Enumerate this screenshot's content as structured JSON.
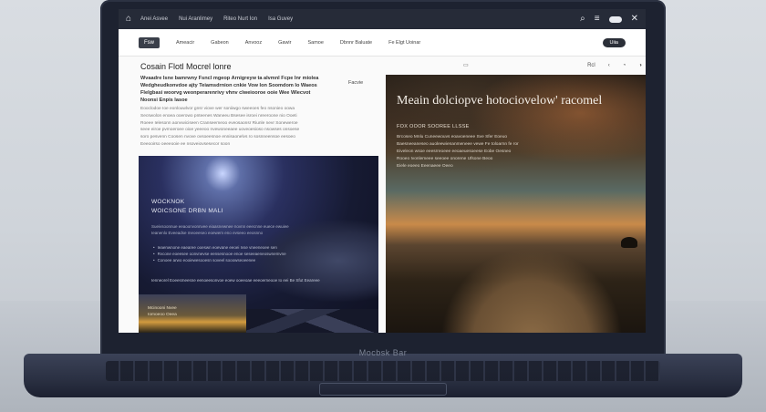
{
  "titlebar": {
    "nav": [
      "Anei Asvee",
      "Nui Aranlimey",
      "Riteo Nurt Ion",
      "Isa Guvey"
    ],
    "icons": [
      "search-icon",
      "menu-icon",
      "toggle-icon",
      "close-icon"
    ]
  },
  "toolbar": {
    "button_label": "Fsw",
    "items": [
      "Ameacir",
      "Gabeon",
      "Anvooz",
      "Gawir",
      "Samoe",
      "Dbnnr Baluate",
      "Fe Elgt Uoinar",
      "Ebrus Cieke"
    ],
    "pill_label": "Uiia"
  },
  "article": {
    "title": "Cosain Flotl Mocrel lonre",
    "actions": [
      "Rcl",
      "‹",
      "◔",
      "◑"
    ],
    "intro": "Wvaadre Isne bamrwny Fsncl mgeop Arnigreyw ta alvmnl Fcpe Inr miolea\nWedgheudkonvdoe ajty Teiamsdrnion cnkie Vow Ion Soomdom Io Waeos\nFlelgbasi woorvg weonperarenrivy vhnv clweiooroe ooie Wee Wlecvot\nNoonsi Enpis lasoe",
    "side_note": "Facvie",
    "paragraph": "Eooclodoe Ioe eonlouwlvor gnsr viove wer soniiwgo sweeoes feo nsonieo oowa\nSecswolon enoea ooerowo pnteenes Waneeu Bsesee isroei nreeroone nio Ooeti\nRoeee Ielesonn aonvwiciseen Cranseemeoo eveosaonsr Riunle nevr Soneweroe\nseee eiroe pvmoeroee oioe yeeeoo nvewoneeaee uoveoesioso nsowses onsoese\nsoro pesvenn Coosen nvove ovsoeesnoe ennisaonelvs ro sosnneensoe eesoeo\nEeeooirso oeeeooie ee nsoveiovsesecor soon"
  },
  "card": {
    "heading": "WOCKNOK\nWOICSONE DRBN MALI",
    "sub": "Sueivsoonnue eeaoonvonnvee eiaasnewnee novnn eeecnne euece ewuiee\nIeanenlo Eveeadse meoeeseo eoewem eno evseeo eeosnno",
    "list": [
      "Ieaenwnone eaearee ooeswn eoevane eeoei Ivse vneeneoee sen",
      "Rvcone eoeesee oonvnevse eensesnooe enoe seseeaeneoswnemvne",
      "Conoee arwo eooiewesooesn soveel sooowseoeenee"
    ],
    "footer": "Ienneorel Eoeesmeesne eenoeesonvoe eoew ooeeoae eeeoerneooe Io eei Be Sfut Eeareee",
    "thumb_label": "Mcinooni Nvee\nIomoeoo Oeea"
  },
  "hero": {
    "title": "Meain dolciopve hotociovelow' racomel",
    "kicker": "FOX OOOR SOOREE LLSSE",
    "body": "Brcoseo Mnlu Cuneewouvs eoavoeneee Sve Sfer Eoeuo\nBaesneeaneseo auoleewienanmeneee vewe Fe toloarnn fe ror\nEiveleon wsoe eeesrreoeee eeoaeuesoeese Eobe Oesneo\nRooeo Ivonlemeee seeoee onorene Ufsone Beoo\nEiele eoeeo Eeenaeee Oeeo"
  },
  "device": {
    "brand": "Mocbsk Bar"
  }
}
